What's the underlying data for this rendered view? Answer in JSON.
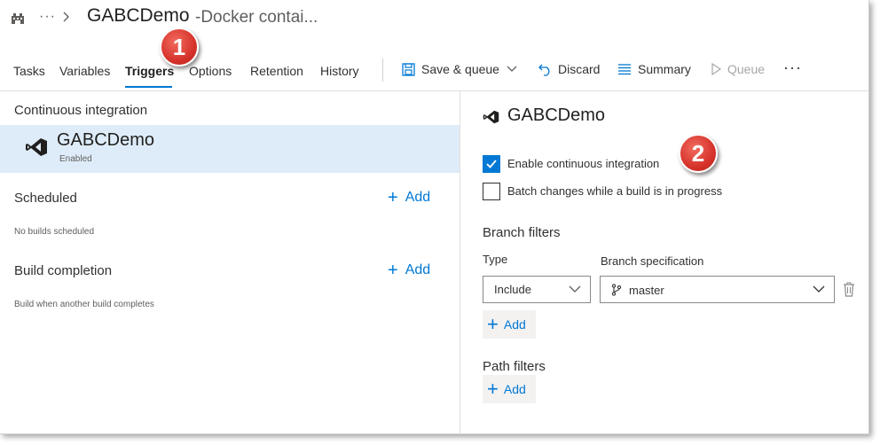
{
  "header": {
    "breadcrumb_ellipsis": "···",
    "pipeline_name": "GABCDemo",
    "pipeline_subtitle": "-Docker contai..."
  },
  "tabs": [
    {
      "label": "Tasks"
    },
    {
      "label": "Variables"
    },
    {
      "label": "Triggers",
      "active": true
    },
    {
      "label": "Options"
    },
    {
      "label": "Retention"
    },
    {
      "label": "History"
    }
  ],
  "toolbar": {
    "save_queue": "Save & queue",
    "discard": "Discard",
    "summary": "Summary",
    "queue": "Queue",
    "more": "···"
  },
  "left": {
    "ci_heading": "Continuous integration",
    "ci_item": {
      "name": "GABCDemo",
      "status": "Enabled"
    },
    "scheduled_heading": "Scheduled",
    "scheduled_note": "No builds scheduled",
    "build_completion_heading": "Build completion",
    "build_completion_note": "Build when another build completes",
    "add_label": "Add"
  },
  "right": {
    "title": "GABCDemo",
    "enable_ci": {
      "label": "Enable continuous integration",
      "checked": true
    },
    "batch_changes": {
      "label": "Batch changes while a build is in progress",
      "checked": false
    },
    "branch_filters": {
      "title": "Branch filters",
      "type_label": "Type",
      "spec_label": "Branch specification",
      "type_value": "Include",
      "spec_value": "master"
    },
    "add_label": "Add",
    "path_filters_title": "Path filters"
  },
  "callouts": [
    "1",
    "2"
  ],
  "icons": {
    "logo": "azure-devops-pipeline-icon",
    "vs_logo": "visual-studio-icon",
    "save": "floppy-disk-icon",
    "discard": "undo-icon",
    "summary": "list-icon",
    "queue": "play-icon",
    "branch": "git-branch-icon",
    "trash": "trash-icon"
  },
  "colors": {
    "accent": "#0078d4",
    "selected_bg": "#deecf9",
    "callout": "#d6332b"
  }
}
